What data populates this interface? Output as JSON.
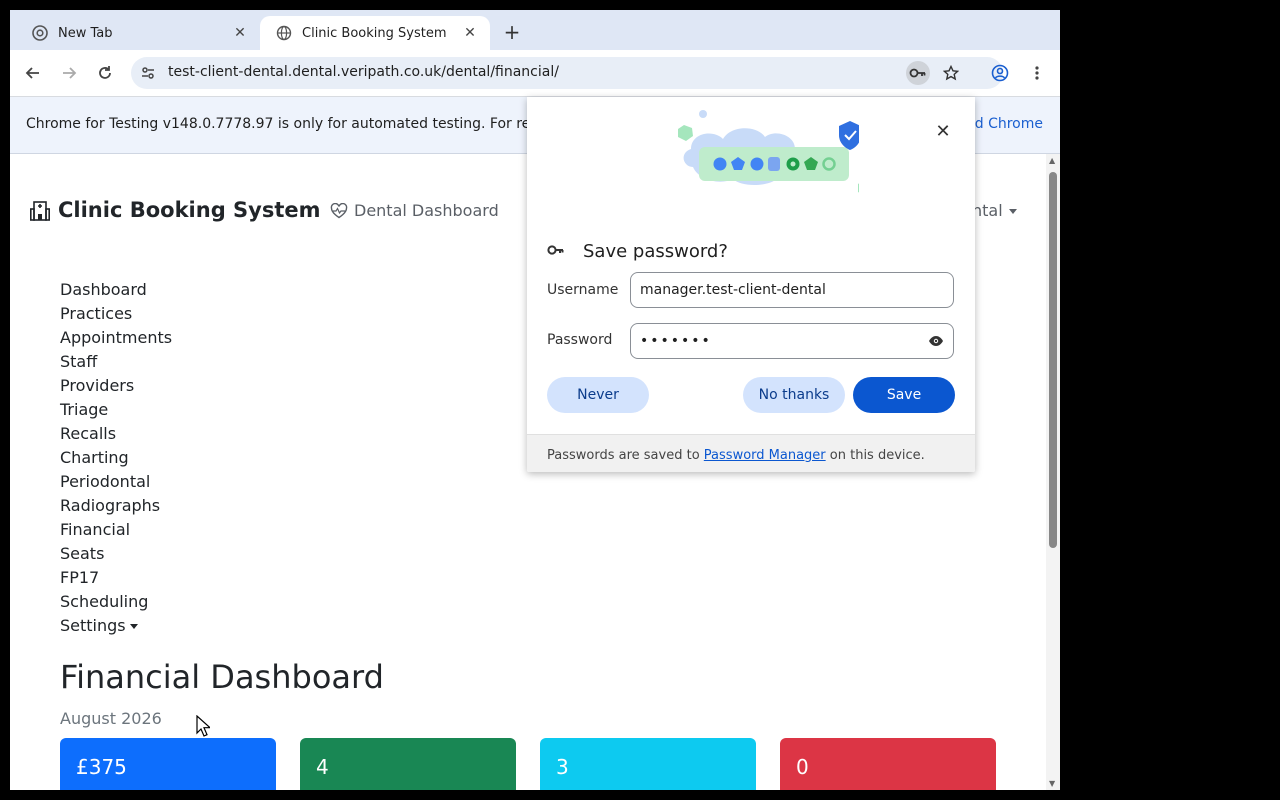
{
  "browser": {
    "tabs": [
      {
        "title": "New Tab",
        "favicon": "chrome-icon"
      },
      {
        "title": "Clinic Booking System",
        "favicon": "globe-icon"
      }
    ],
    "url": "test-client-dental.dental.veripath.co.uk/dental/financial/"
  },
  "infobar": {
    "text": "Chrome for Testing v148.0.7778.97 is only for automated testing. For re",
    "link": "d Chrome"
  },
  "header": {
    "brand": "Clinic Booking System",
    "nav_link": "Dental Dashboard",
    "user_menu": "ntal"
  },
  "sidebar": {
    "items": [
      {
        "label": "Dashboard"
      },
      {
        "label": "Practices"
      },
      {
        "label": "Appointments"
      },
      {
        "label": "Staff"
      },
      {
        "label": "Providers"
      },
      {
        "label": "Triage"
      },
      {
        "label": "Recalls"
      },
      {
        "label": "Charting"
      },
      {
        "label": "Periodontal"
      },
      {
        "label": "Radiographs"
      },
      {
        "label": "Financial"
      },
      {
        "label": "Seats"
      },
      {
        "label": "FP17"
      },
      {
        "label": "Scheduling"
      },
      {
        "label": "Settings"
      }
    ]
  },
  "main": {
    "title": "Financial Dashboard",
    "subtitle": "August 2026",
    "cards": [
      {
        "value": "£375",
        "color": "#0d6efd"
      },
      {
        "value": "4",
        "color": "#198754"
      },
      {
        "value": "3",
        "color": "#0dcaf0"
      },
      {
        "value": "0",
        "color": "#dc3545"
      }
    ]
  },
  "password_bubble": {
    "title": "Save password?",
    "username_label": "Username",
    "username_value": "manager.test-client-dental",
    "password_label": "Password",
    "password_value": "•••••••",
    "never_button": "Never",
    "no_thanks_button": "No thanks",
    "save_button": "Save",
    "footer_prefix": "Passwords are saved to",
    "footer_link": "Password Manager",
    "footer_suffix": "on this device."
  }
}
